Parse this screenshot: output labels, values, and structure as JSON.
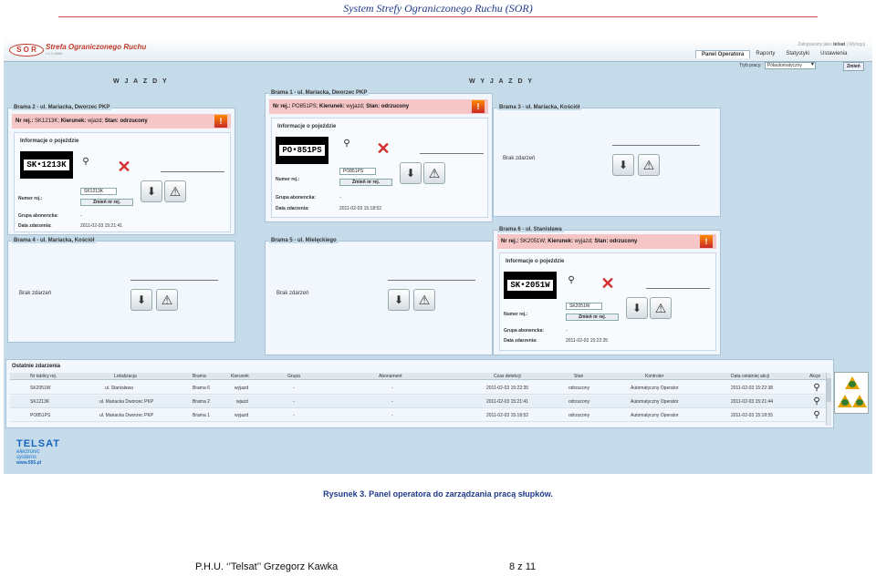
{
  "document": {
    "header_title": "System Strefy Ograniczonego Ruchu (SOR)",
    "caption": "Rysunek 3. Panel operatora do zarządzania pracą słupków.",
    "footer_company": "P.H.U. ‘’Telsat’’ Grzegorz Kawka",
    "footer_page": "8 z 11",
    "accent_color": "#1f3a8a",
    "rule_color": "#c0504d"
  },
  "app": {
    "logo_text": "S O R",
    "name": "Strefa Ograniczonego Ruchu",
    "version": "v.1.0.8888",
    "login_prefix": "Zalogowany jako",
    "login_user": "telsat",
    "logout_label": "Wyloguj",
    "nav": [
      "Panel Operatora",
      "Raporty",
      "Statystyki",
      "Ustawienia"
    ],
    "mode_label": "Tryb pracy:",
    "mode_value": "Półautomatyczny",
    "change_label": "Zmień"
  },
  "columns": {
    "in": "W J A Z D Y",
    "out": "W Y J A Z D Y"
  },
  "labels": {
    "info": "Informacje o pojeździe",
    "reg_no": "Numer rej.:",
    "group": "Grupa abonencka:",
    "event_date": "Data zdarzenia:",
    "change_reg": "Zmień nr rej.",
    "no_events": "Brak zdarzeń",
    "alert_reg": "Nr rej.:",
    "alert_dir": "Kierunek:",
    "alert_state": "Stan:"
  },
  "gates": {
    "g2": {
      "title": "Brama 2 - ul. Mariacka, Dworzec PKP",
      "reg": "SK1213K",
      "dir": "wjazd",
      "state": "odrzucony",
      "plate": "SK•1213K",
      "group": "-",
      "date": "2011-02-03 15:21:41"
    },
    "g1": {
      "title": "Brama 1 - ul. Mariacka, Dworzec PKP",
      "reg": "PO851PS",
      "dir": "wyjazd",
      "state": "odrzucony",
      "plate": "PO•851PS",
      "group": "-",
      "date": "2011-02-03 15:18:52"
    },
    "g3": {
      "title": "Brama 3 - ul. Mariacka, Kościół"
    },
    "g6": {
      "title": "Brama 6 - ul. Stanisława",
      "reg": "SK2051W",
      "dir": "wyjazd",
      "state": "odrzucony",
      "plate": "SK•2051W",
      "group": "-",
      "date": "2011-02-03 15:22:35"
    },
    "g4": {
      "title": "Brama 4 - ul. Mariacka, Kościół"
    },
    "g5": {
      "title": "Brama 5 - ul. Mielęckiego"
    }
  },
  "events": {
    "title": "Ostatnie zdarzenia",
    "columns": [
      "Nr tablicy rej.",
      "Lokalizacja",
      "Brama",
      "Kierunek",
      "Grupa",
      "Abonament",
      "Czas detekcji",
      "Stan",
      "Kontroler",
      "Data ostatniej akcji",
      "Akcje"
    ],
    "rows": [
      [
        "SK2051W",
        "ul. Stanisława",
        "Brama 6",
        "wyjazd",
        "-",
        "-",
        "2011-02-03 15:22:35",
        "odrzucony",
        "Automatyczny Operator",
        "2011-02-03 15:22:38"
      ],
      [
        "SK1213K",
        "ul. Mariacka Dworzec PKP",
        "Brama 2",
        "wjazd",
        "-",
        "-",
        "2011-02-03 15:21:41",
        "odrzucony",
        "Automatyczny Operator",
        "2011-02-03 15:21:44"
      ],
      [
        "PO851PS",
        "ul. Mariacka Dworzec PKP",
        "Brama 1",
        "wyjazd",
        "-",
        "-",
        "2011-02-03 15:18:52",
        "odrzucony",
        "Automatyczny Operator",
        "2011-02-03 15:18:55"
      ]
    ]
  },
  "branding": {
    "line1": "TELSAT",
    "line2": "electronic",
    "line3": "systems",
    "line4": "www.555.pl"
  }
}
